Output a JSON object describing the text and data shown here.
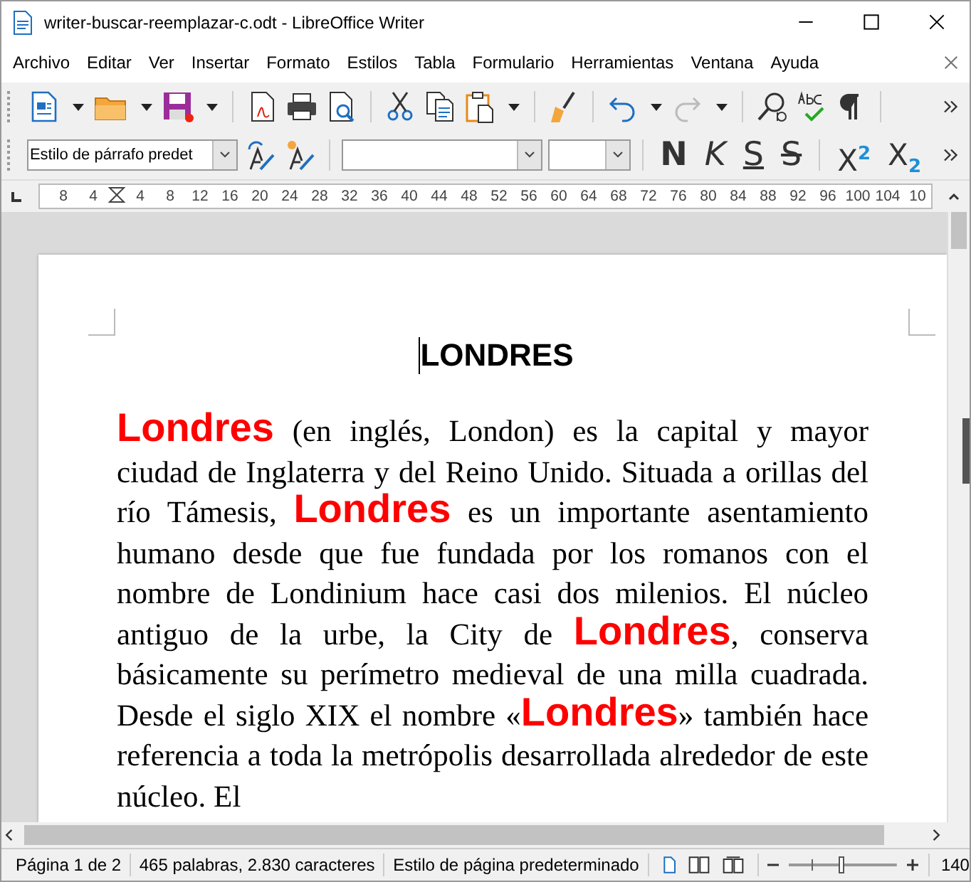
{
  "window": {
    "title": "writer-buscar-reemplazar-c.odt - LibreOffice Writer"
  },
  "menu": [
    "Archivo",
    "Editar",
    "Ver",
    "Insertar",
    "Formato",
    "Estilos",
    "Tabla",
    "Formulario",
    "Herramientas",
    "Ventana",
    "Ayuda"
  ],
  "format_bar": {
    "paragraph_style": "Estilo de párrafo predet",
    "buttons": [
      {
        "kind": "bold",
        "label": "N"
      },
      {
        "kind": "italic",
        "label": "K"
      },
      {
        "kind": "underline",
        "label": "S"
      },
      {
        "kind": "strike",
        "label": "S"
      },
      {
        "kind": "super",
        "label": "X$^{2}$"
      },
      {
        "kind": "sub",
        "label": "X$_{2}$"
      }
    ]
  },
  "ruler": [
    "8",
    "4",
    "4",
    "8",
    "12",
    "16",
    "20",
    "24",
    "28",
    "32",
    "36",
    "40",
    "44",
    "48",
    "52",
    "56",
    "60",
    "64",
    "68",
    "72",
    "76",
    "80",
    "84",
    "88",
    "92",
    "96",
    "100",
    "104",
    "10"
  ],
  "document": {
    "heading": "LONDRES",
    "paragraph": [
      {
        "kind": "highlight",
        "text": "Londres"
      },
      {
        "kind": "plain",
        "text": " (en inglés, London) es la capital y mayor ciudad de Inglaterra y del Reino Unido. Situada a orillas del río Támesis, "
      },
      {
        "kind": "highlight",
        "text": "Londres"
      },
      {
        "kind": "plain",
        "text": " es un importante asentamiento humano desde que fue fundada por los romanos con el nombre de Londinium hace casi dos milenios. El núcleo antiguo de la urbe, la City de "
      },
      {
        "kind": "highlight",
        "text": "Londres"
      },
      {
        "kind": "plain",
        "text": ", conserva básicamente su perímetro medieval de una milla cuadrada. Desde el siglo XIX el nombre «"
      },
      {
        "kind": "highlight",
        "text": "Londres"
      },
      {
        "kind": "plain",
        "text": "» también hace referencia a toda la metrópolis desarrollada alrededor de este núcleo. El"
      }
    ]
  },
  "status_bar": {
    "page": "Página 1 de 2",
    "words": "465 palabras, 2.830 caracteres",
    "page_style": "Estilo de página predeterminado",
    "zoom": {
      "level": 0.5,
      "reading": "140"
    }
  }
}
